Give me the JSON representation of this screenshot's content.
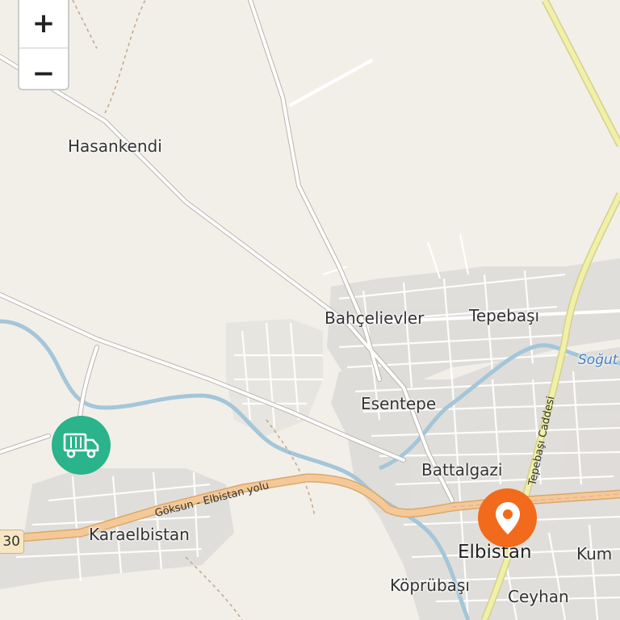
{
  "map": {
    "places": {
      "hasankendi": "Hasankendi",
      "bahcelievler": "Bahçelievler",
      "tepebasi": "Tepebaşı",
      "esentepe": "Esentepe",
      "battalgazi": "Battalgazi",
      "karaelbistan": "Karaelbistan",
      "elbistan": "Elbistan",
      "koprubasi": "Köprübaşı",
      "ceyhan": "Ceyhan",
      "kum": "Kum"
    },
    "water_label": "Soğut",
    "roads": {
      "goksun_elbistan": "Göksun - Elbistan yolu",
      "tepebasi_caddesi": "Tepebaşı Caddesi",
      "route_shield": "30"
    },
    "controls": {
      "zoom_in": "+",
      "zoom_out": "−"
    },
    "markers": {
      "depot_icon": "truck-icon",
      "destination_icon": "map-pin-icon"
    },
    "colors": {
      "background": "#f2efe9",
      "river": "#a4c6d9",
      "primary_road": "#f4c997",
      "trunk_road": "#f0f0a8",
      "depot_marker": "#2bb38b",
      "destination_marker": "#f26a1b"
    }
  }
}
